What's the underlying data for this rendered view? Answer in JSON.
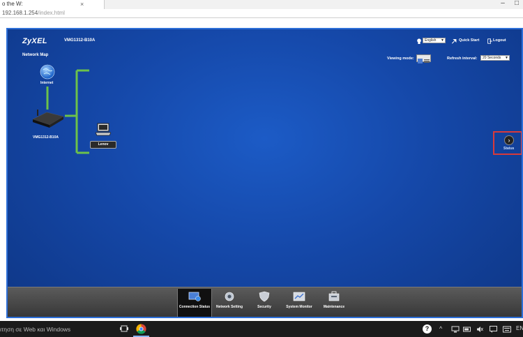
{
  "browser": {
    "tab_title": "o the W:",
    "tab_close": "×",
    "url_host": "192.168.1.254",
    "url_path": "/index.html",
    "window_minimize": "–",
    "window_restore": "□"
  },
  "router_ui": {
    "brand": "ZyXEL",
    "model": "VMG1312-B10A",
    "header": {
      "language_value": "English",
      "quick_start_label": "Quick Start",
      "logout_label": "Logout"
    },
    "network_map": {
      "title": "Network Map",
      "viewing_mode_label": "Viewing mode:",
      "refresh_label": "Refresh interval:",
      "refresh_value": "20 Seconds",
      "internet_label": "Internet",
      "router_label": "VMG1312-B10A",
      "client_label": "Lenov"
    },
    "status_panel": {
      "label": "Status",
      "arrow": "›"
    },
    "nav": [
      {
        "label": "Connection Status",
        "icon": "monitor-globe-icon",
        "active": true
      },
      {
        "label": "Network Setting",
        "icon": "gear-icon",
        "active": false
      },
      {
        "label": "Security",
        "icon": "shield-icon",
        "active": false
      },
      {
        "label": "System Monitor",
        "icon": "chart-icon",
        "active": false
      },
      {
        "label": "Maintenance",
        "icon": "toolbox-icon",
        "active": false
      }
    ],
    "colors": {
      "background": "#1548a9",
      "frame_border": "#2d6fd8",
      "map_lines": "#6cc24a",
      "highlight": "#d93a3a"
    }
  },
  "taskbar": {
    "search_text": "ιτηση σε Web και Windows",
    "apps": [
      "task-view-icon",
      "chrome-icon"
    ],
    "tray": {
      "help": "?",
      "chevron": "^",
      "language": "ENG"
    }
  }
}
